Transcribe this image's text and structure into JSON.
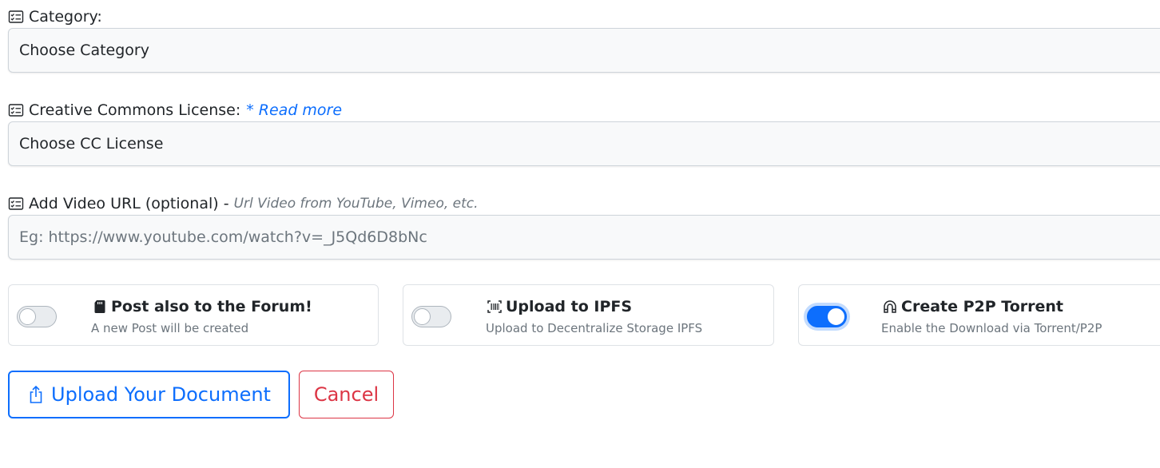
{
  "category": {
    "label": "Category:",
    "icon": "list-check-icon",
    "selected": "Choose Category"
  },
  "license": {
    "label": "Creative Commons License:",
    "icon": "list-check-icon",
    "read_more": "* Read more",
    "selected": "Choose CC License"
  },
  "video": {
    "label": "Add Video URL (optional) -",
    "hint": "Url Video from YouTube, Vimeo, etc.",
    "icon": "list-check-icon",
    "value": "",
    "placeholder": "Eg: https://www.youtube.com/watch?v=_J5Qd6D8bNc"
  },
  "options": [
    {
      "title": "Post also to the Forum!",
      "subtitle": "A new Post will be created",
      "icon": "sd-card-icon",
      "enabled": false
    },
    {
      "title": "Upload to IPFS",
      "subtitle": "Upload to Decentralize Storage IPFS",
      "icon": "upc-scan-icon",
      "enabled": false
    },
    {
      "title": "Create P2P Torrent",
      "subtitle": "Enable the Download via Torrent/P2P",
      "icon": "magnet-icon",
      "enabled": true
    }
  ],
  "actions": {
    "upload_label": "Upload Your Document",
    "upload_icon": "box-arrow-up-icon",
    "cancel_label": "Cancel"
  },
  "colors": {
    "primary": "#0d6efd",
    "danger": "#dc3545",
    "muted": "#6c757d",
    "input_bg": "#f8f9fa"
  }
}
